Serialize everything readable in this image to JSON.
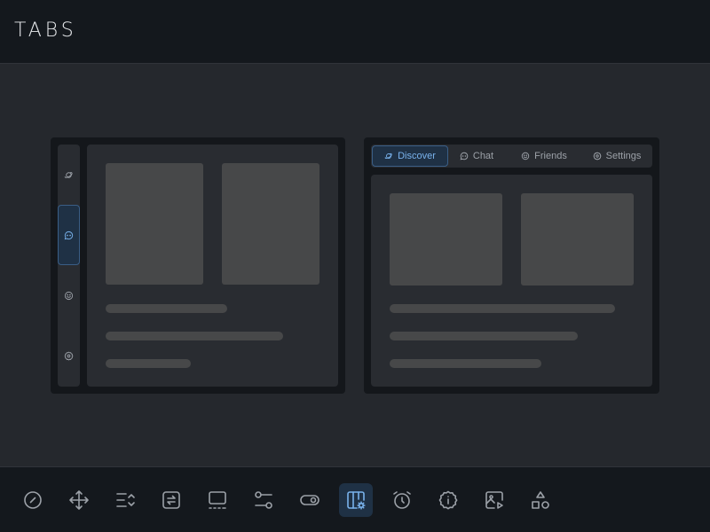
{
  "header": {
    "title": "TABS"
  },
  "colors": {
    "accent": "#79b2ec",
    "icon": "#9ca1a8",
    "active_bg": "#1f3145",
    "placeholder": "#474849"
  },
  "left_demo": {
    "tabs": [
      {
        "icon": "planet-icon",
        "active": false
      },
      {
        "icon": "chat-icon",
        "active": true
      },
      {
        "icon": "smiley-icon",
        "active": false
      },
      {
        "icon": "gear-icon",
        "active": false
      }
    ]
  },
  "right_demo": {
    "tabs": [
      {
        "label": "Discover",
        "icon": "planet-icon",
        "active": true
      },
      {
        "label": "Chat",
        "icon": "chat-icon",
        "active": false
      },
      {
        "label": "Friends",
        "icon": "smiley-icon",
        "active": false
      },
      {
        "label": "Settings",
        "icon": "gear-icon",
        "active": false
      }
    ]
  },
  "toolbar": {
    "tools": [
      {
        "icon": "slash-circle-icon",
        "active": false
      },
      {
        "icon": "move-arrows-icon",
        "active": false
      },
      {
        "icon": "sort-list-icon",
        "active": false
      },
      {
        "icon": "swap-arrows-icon",
        "active": false
      },
      {
        "icon": "screen-icon",
        "active": false
      },
      {
        "icon": "sliders-icon",
        "active": false
      },
      {
        "icon": "toggle-icon",
        "active": false
      },
      {
        "icon": "tabs-settings-icon",
        "active": true
      },
      {
        "icon": "alarm-clock-icon",
        "active": false
      },
      {
        "icon": "info-badge-icon",
        "active": false
      },
      {
        "icon": "image-play-icon",
        "active": false
      },
      {
        "icon": "shapes-icon",
        "active": false
      }
    ]
  }
}
